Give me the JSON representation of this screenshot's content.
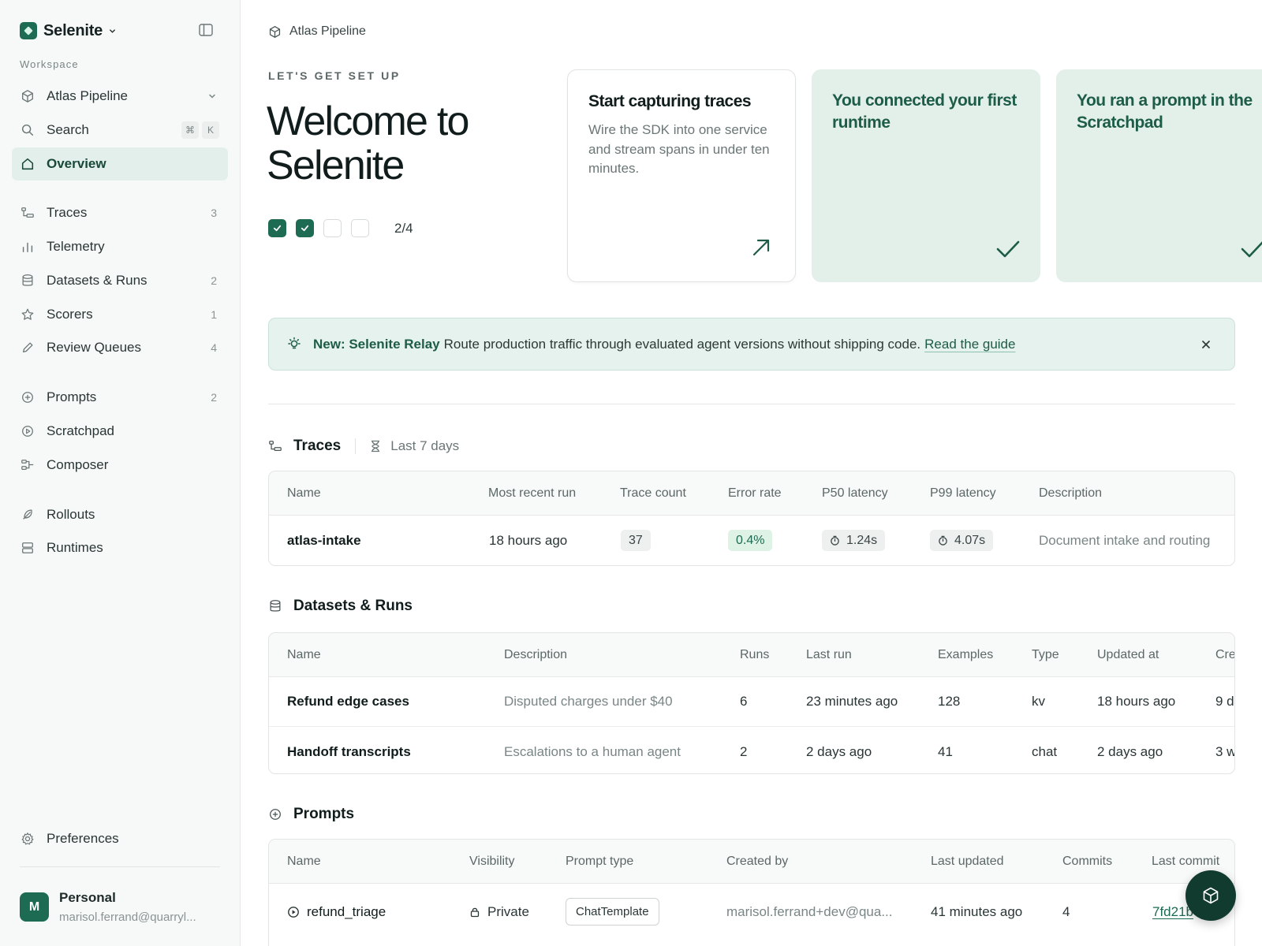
{
  "app": {
    "name": "Selenite"
  },
  "sidebar": {
    "workspace_label": "Workspace",
    "workspace": "Atlas Pipeline",
    "search": {
      "label": "Search",
      "shortcut": [
        "⌘",
        "K"
      ]
    },
    "items": [
      {
        "label": "Overview",
        "count": ""
      },
      {
        "label": "Traces",
        "count": "3"
      },
      {
        "label": "Telemetry",
        "count": ""
      },
      {
        "label": "Datasets & Runs",
        "count": "2"
      },
      {
        "label": "Scorers",
        "count": "1"
      },
      {
        "label": "Review Queues",
        "count": "4"
      },
      {
        "label": "Prompts",
        "count": "2"
      },
      {
        "label": "Scratchpad",
        "count": ""
      },
      {
        "label": "Composer",
        "count": ""
      },
      {
        "label": "Rollouts",
        "count": ""
      },
      {
        "label": "Runtimes",
        "count": ""
      }
    ],
    "preferences": "Preferences",
    "user": {
      "initial": "M",
      "name": "Personal",
      "email": "marisol.ferrand@quarryl..."
    }
  },
  "breadcrumb": "Atlas Pipeline",
  "hero": {
    "eyebrow": "LET'S GET SET UP",
    "title": "Welcome to Selenite",
    "progress_text": "2/4",
    "steps_done": 2,
    "steps_total": 4
  },
  "cards": [
    {
      "title": "Start capturing traces",
      "desc": "Wire the SDK into one service and stream spans in under ten minutes.",
      "done": false
    },
    {
      "title": "You connected your first runtime",
      "desc": "",
      "done": true
    },
    {
      "title": "You ran a prompt in the Scratchpad",
      "desc": "",
      "done": true
    }
  ],
  "banner": {
    "strong": "New: Selenite Relay",
    "text": "Route production traffic through evaluated agent versions without shipping code.",
    "link": "Read the guide"
  },
  "traces": {
    "title": "Traces",
    "range": "Last 7 days",
    "columns": [
      "Name",
      "Most recent run",
      "Trace count",
      "Error rate",
      "P50 latency",
      "P99 latency",
      "Description"
    ],
    "rows": [
      {
        "name": "atlas-intake",
        "recent": "18 hours ago",
        "count": "37",
        "error": "0.4%",
        "p50": "1.24s",
        "p99": "4.07s",
        "desc": "Document intake and routing"
      }
    ]
  },
  "datasets": {
    "title": "Datasets & Runs",
    "columns": [
      "Name",
      "Description",
      "Runs",
      "Last run",
      "Examples",
      "Type",
      "Updated at",
      "Cre"
    ],
    "rows": [
      {
        "name": "Refund edge cases",
        "desc": "Disputed charges under $40",
        "runs": "6",
        "last_run": "23 minutes ago",
        "examples": "128",
        "type": "kv",
        "updated": "18 hours ago",
        "created": "9 d"
      },
      {
        "name": "Handoff transcripts",
        "desc": "Escalations to a human agent",
        "runs": "2",
        "last_run": "2 days ago",
        "examples": "41",
        "type": "chat",
        "updated": "2 days ago",
        "created": "3 w"
      }
    ]
  },
  "prompts": {
    "title": "Prompts",
    "columns": [
      "Name",
      "Visibility",
      "Prompt type",
      "Created by",
      "Last updated",
      "Commits",
      "Last commit"
    ],
    "rows": [
      {
        "name": "refund_triage",
        "visibility": "Private",
        "type": "ChatTemplate",
        "created_by": "marisol.ferrand+dev@qua...",
        "updated": "41 minutes ago",
        "commits": "4",
        "last_commit": "7fd21b"
      }
    ]
  },
  "colors": {
    "accent": "#1d6b52",
    "mint": "#e3f0ea",
    "fab": "#123b30"
  }
}
